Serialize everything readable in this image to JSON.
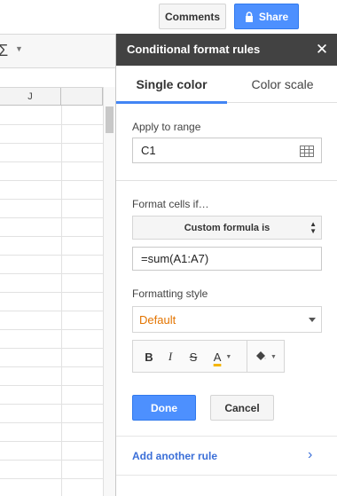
{
  "toolbar": {
    "comments_label": "Comments",
    "share_label": "Share",
    "sigma_symbol": "Σ",
    "column_label": "J"
  },
  "panel": {
    "title": "Conditional format rules",
    "close_symbol": "✕",
    "tabs": [
      {
        "label": "Single color",
        "active": true
      },
      {
        "label": "Color scale",
        "active": false
      }
    ],
    "apply_to_range": {
      "label": "Apply to range",
      "value": "C1"
    },
    "format_cells": {
      "label": "Format cells if…",
      "condition": "Custom formula is",
      "formula": "=sum(A1:A7)"
    },
    "formatting_style": {
      "label": "Formatting style",
      "value": "Default",
      "bold": "B",
      "italic": "I",
      "strike": "S",
      "text_color": "A"
    },
    "done_label": "Done",
    "cancel_label": "Cancel",
    "add_rule_label": "Add another rule"
  },
  "colors": {
    "accent_blue": "#4d90fe",
    "header_dark": "#424242",
    "default_style_orange": "#e37400",
    "text_color_underline": "#f4b400"
  }
}
